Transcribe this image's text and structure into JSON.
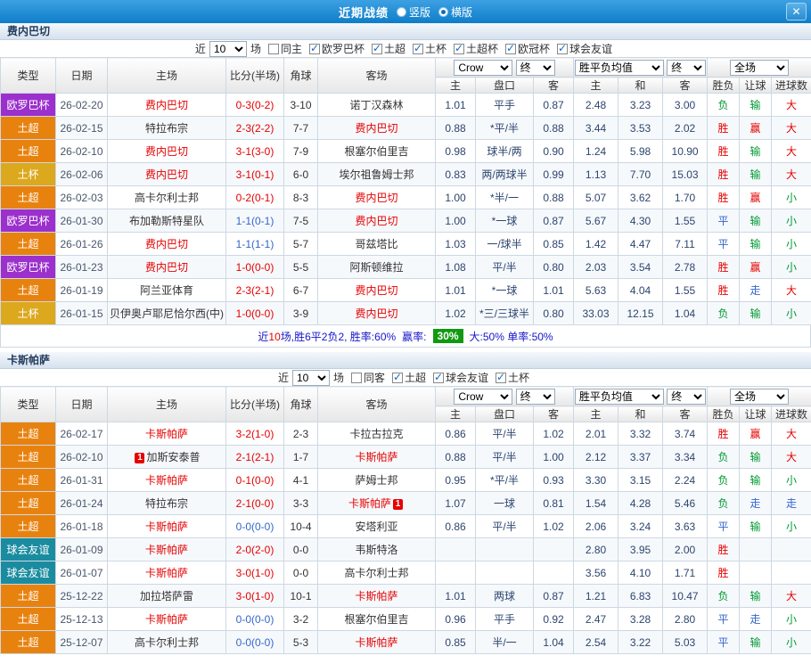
{
  "titlebar": {
    "title": "近期战绩",
    "layout_vertical": "竖版",
    "layout_horizontal": "横版",
    "selected_layout": "横版",
    "close": "✕"
  },
  "colors": {
    "titlebar_blue": "#1486d8",
    "europa_purple": "#9b30cc",
    "super_league_orange": "#e8820f",
    "cup_gold": "#dca81e",
    "friendly_teal": "#1b8ca0",
    "win_red": "#e60000",
    "lose_green": "#009933",
    "draw_blue": "#3366cc",
    "rate_badge_green": "#119911"
  },
  "columns": {
    "type": "类型",
    "date": "日期",
    "home": "主场",
    "score": "比分(半场)",
    "corner": "角球",
    "away": "客场",
    "crow": "Crow",
    "final": "终",
    "avg": "胜平负均值",
    "scope": "全场",
    "odds_home": "主",
    "odds_line": "盘口",
    "odds_away": "客",
    "avg_home": "主",
    "avg_draw": "和",
    "avg_away": "客",
    "result": "胜负",
    "let_ball": "让球",
    "goals": "进球数"
  },
  "filter": {
    "near": "近",
    "count": "10",
    "unit": "场"
  },
  "sections": [
    {
      "team": "费内巴切",
      "filters": [
        {
          "label": "同主",
          "state": "off"
        },
        {
          "label": "欧罗巴杯",
          "state": "on"
        },
        {
          "label": "土超",
          "state": "on"
        },
        {
          "label": "土杯",
          "state": "on"
        },
        {
          "label": "土超杯",
          "state": "on"
        },
        {
          "label": "欧冠杯",
          "state": "on"
        },
        {
          "label": "球会友谊",
          "state": "on"
        }
      ],
      "rows": [
        {
          "type": "欧罗巴杯",
          "tcls": "purple",
          "date": "26-02-20",
          "home": "费内巴切",
          "hcls": "hl",
          "score": "0-3(0-2)",
          "scls": "red",
          "corner": "3-10",
          "away": "诺丁汉森林",
          "acls": "",
          "c1": "1.01",
          "line": "平手",
          "c2": "0.87",
          "m1": "2.48",
          "m2": "3.23",
          "m3": "3.00",
          "res": "负",
          "rcls": "green",
          "let": "输",
          "lcls": "green",
          "big": "大",
          "bcls": "red"
        },
        {
          "type": "土超",
          "tcls": "orange",
          "date": "26-02-15",
          "home": "特拉布宗",
          "hcls": "",
          "score": "2-3(2-2)",
          "scls": "red",
          "corner": "7-7",
          "away": "费内巴切",
          "acls": "hl",
          "c1": "0.88",
          "line": "*平/半",
          "c2": "0.88",
          "m1": "3.44",
          "m2": "3.53",
          "m3": "2.02",
          "res": "胜",
          "rcls": "red",
          "let": "赢",
          "lcls": "red",
          "big": "大",
          "bcls": "red"
        },
        {
          "type": "土超",
          "tcls": "orange",
          "date": "26-02-10",
          "home": "费内巴切",
          "hcls": "hl",
          "score": "3-1(3-0)",
          "scls": "red",
          "corner": "7-9",
          "away": "根塞尔伯里吉",
          "acls": "",
          "c1": "0.98",
          "line": "球半/两",
          "c2": "0.90",
          "m1": "1.24",
          "m2": "5.98",
          "m3": "10.90",
          "res": "胜",
          "rcls": "red",
          "let": "输",
          "lcls": "green",
          "big": "大",
          "bcls": "red"
        },
        {
          "type": "土杯",
          "tcls": "gold",
          "date": "26-02-06",
          "home": "费内巴切",
          "hcls": "hl",
          "score": "3-1(0-1)",
          "scls": "red",
          "corner": "6-0",
          "away": "埃尔祖鲁姆士邦",
          "acls": "",
          "c1": "0.83",
          "line": "两/两球半",
          "c2": "0.99",
          "m1": "1.13",
          "m2": "7.70",
          "m3": "15.03",
          "res": "胜",
          "rcls": "red",
          "let": "输",
          "lcls": "green",
          "big": "大",
          "bcls": "red"
        },
        {
          "type": "土超",
          "tcls": "orange",
          "date": "26-02-03",
          "home": "高卡尔利士邦",
          "hcls": "",
          "score": "0-2(0-1)",
          "scls": "red",
          "corner": "8-3",
          "away": "费内巴切",
          "acls": "hl",
          "c1": "1.00",
          "line": "*半/一",
          "c2": "0.88",
          "m1": "5.07",
          "m2": "3.62",
          "m3": "1.70",
          "res": "胜",
          "rcls": "red",
          "let": "赢",
          "lcls": "red",
          "big": "小",
          "bcls": "green"
        },
        {
          "type": "欧罗巴杯",
          "tcls": "purple",
          "date": "26-01-30",
          "home": "布加勒斯特星队",
          "hcls": "",
          "score": "1-1(0-1)",
          "scls": "blue",
          "corner": "7-5",
          "away": "费内巴切",
          "acls": "hl",
          "c1": "1.00",
          "line": "*一球",
          "c2": "0.87",
          "m1": "5.67",
          "m2": "4.30",
          "m3": "1.55",
          "res": "平",
          "rcls": "blue",
          "let": "输",
          "lcls": "green",
          "big": "小",
          "bcls": "green"
        },
        {
          "type": "土超",
          "tcls": "orange",
          "date": "26-01-26",
          "home": "费内巴切",
          "hcls": "hl",
          "score": "1-1(1-1)",
          "scls": "blue",
          "corner": "5-7",
          "away": "哥兹塔比",
          "acls": "",
          "c1": "1.03",
          "line": "一/球半",
          "c2": "0.85",
          "m1": "1.42",
          "m2": "4.47",
          "m3": "7.11",
          "res": "平",
          "rcls": "blue",
          "let": "输",
          "lcls": "green",
          "big": "小",
          "bcls": "green"
        },
        {
          "type": "欧罗巴杯",
          "tcls": "purple",
          "date": "26-01-23",
          "home": "费内巴切",
          "hcls": "hl",
          "score": "1-0(0-0)",
          "scls": "red",
          "corner": "5-5",
          "away": "阿斯顿维拉",
          "acls": "",
          "c1": "1.08",
          "line": "平/半",
          "c2": "0.80",
          "m1": "2.03",
          "m2": "3.54",
          "m3": "2.78",
          "res": "胜",
          "rcls": "red",
          "let": "赢",
          "lcls": "red",
          "big": "小",
          "bcls": "green"
        },
        {
          "type": "土超",
          "tcls": "orange",
          "date": "26-01-19",
          "home": "阿兰亚体育",
          "hcls": "",
          "score": "2-3(2-1)",
          "scls": "red",
          "corner": "6-7",
          "away": "费内巴切",
          "acls": "hl",
          "c1": "1.01",
          "line": "*一球",
          "c2": "1.01",
          "m1": "5.63",
          "m2": "4.04",
          "m3": "1.55",
          "res": "胜",
          "rcls": "red",
          "let": "走",
          "lcls": "blue",
          "big": "大",
          "bcls": "red"
        },
        {
          "type": "土杯",
          "tcls": "gold",
          "date": "26-01-15",
          "home": "贝伊奥卢耶尼恰尔西(中)",
          "hcls": "",
          "score": "1-0(0-0)",
          "scls": "red",
          "corner": "3-9",
          "away": "费内巴切",
          "acls": "hl",
          "c1": "1.02",
          "line": "*三/三球半",
          "c2": "0.80",
          "m1": "33.03",
          "m2": "12.15",
          "m3": "1.04",
          "res": "负",
          "rcls": "green",
          "let": "输",
          "lcls": "green",
          "big": "小",
          "bcls": "green"
        }
      ],
      "summary": {
        "near": "近",
        "count": "10",
        "stats": "场,胜6平2负2, 胜率:60%",
        "win_label": "赢率:",
        "win_rate": "30%",
        "tail": "大:50% 单率:50%"
      }
    },
    {
      "team": "卡斯帕萨",
      "filters": [
        {
          "label": "同客",
          "state": "off"
        },
        {
          "label": "土超",
          "state": "on"
        },
        {
          "label": "球会友谊",
          "state": "on"
        },
        {
          "label": "土杯",
          "state": "on"
        }
      ],
      "rows": [
        {
          "type": "土超",
          "tcls": "orange",
          "date": "26-02-17",
          "home": "卡斯帕萨",
          "hcls": "hl",
          "score": "3-2(1-0)",
          "scls": "red",
          "corner": "2-3",
          "away": "卡拉古拉克",
          "acls": "",
          "c1": "0.86",
          "line": "平/半",
          "c2": "1.02",
          "m1": "2.01",
          "m2": "3.32",
          "m3": "3.74",
          "res": "胜",
          "rcls": "red",
          "let": "赢",
          "lcls": "red",
          "big": "大",
          "bcls": "red"
        },
        {
          "type": "土超",
          "tcls": "orange",
          "date": "26-02-10",
          "hpre": "1",
          "home": "加斯安泰普",
          "hcls": "",
          "score": "2-1(2-1)",
          "scls": "red",
          "corner": "1-7",
          "away": "卡斯帕萨",
          "acls": "hl",
          "c1": "0.88",
          "line": "平/半",
          "c2": "1.00",
          "m1": "2.12",
          "m2": "3.37",
          "m3": "3.34",
          "res": "负",
          "rcls": "green",
          "let": "输",
          "lcls": "green",
          "big": "大",
          "bcls": "red"
        },
        {
          "type": "土超",
          "tcls": "orange",
          "date": "26-01-31",
          "home": "卡斯帕萨",
          "hcls": "hl",
          "score": "0-1(0-0)",
          "scls": "red",
          "corner": "4-1",
          "away": "萨姆士邦",
          "acls": "",
          "c1": "0.95",
          "line": "*平/半",
          "c2": "0.93",
          "m1": "3.30",
          "m2": "3.15",
          "m3": "2.24",
          "res": "负",
          "rcls": "green",
          "let": "输",
          "lcls": "green",
          "big": "小",
          "bcls": "green"
        },
        {
          "type": "土超",
          "tcls": "orange",
          "date": "26-01-24",
          "home": "特拉布宗",
          "hcls": "",
          "score": "2-1(0-0)",
          "scls": "red",
          "corner": "3-3",
          "away": "卡斯帕萨",
          "acls": "hl",
          "apost": "1",
          "c1": "1.07",
          "line": "一球",
          "c2": "0.81",
          "m1": "1.54",
          "m2": "4.28",
          "m3": "5.46",
          "res": "负",
          "rcls": "green",
          "let": "走",
          "lcls": "blue",
          "big": "走",
          "bcls": "blue"
        },
        {
          "type": "土超",
          "tcls": "orange",
          "date": "26-01-18",
          "home": "卡斯帕萨",
          "hcls": "hl",
          "score": "0-0(0-0)",
          "scls": "blue",
          "corner": "10-4",
          "away": "安塔利亚",
          "acls": "",
          "c1": "0.86",
          "line": "平/半",
          "c2": "1.02",
          "m1": "2.06",
          "m2": "3.24",
          "m3": "3.63",
          "res": "平",
          "rcls": "blue",
          "let": "输",
          "lcls": "green",
          "big": "小",
          "bcls": "green"
        },
        {
          "type": "球会友谊",
          "tcls": "teal",
          "date": "26-01-09",
          "home": "卡斯帕萨",
          "hcls": "hl",
          "score": "2-0(2-0)",
          "scls": "red",
          "corner": "0-0",
          "away": "韦斯特洛",
          "acls": "",
          "c1": "",
          "line": "",
          "c2": "",
          "m1": "2.80",
          "m2": "3.95",
          "m3": "2.00",
          "res": "胜",
          "rcls": "red",
          "let": "",
          "lcls": "",
          "big": "",
          "bcls": ""
        },
        {
          "type": "球会友谊",
          "tcls": "teal",
          "date": "26-01-07",
          "home": "卡斯帕萨",
          "hcls": "hl",
          "score": "3-0(1-0)",
          "scls": "red",
          "corner": "0-0",
          "away": "高卡尔利士邦",
          "acls": "",
          "c1": "",
          "line": "",
          "c2": "",
          "m1": "3.56",
          "m2": "4.10",
          "m3": "1.71",
          "res": "胜",
          "rcls": "red",
          "let": "",
          "lcls": "",
          "big": "",
          "bcls": ""
        },
        {
          "type": "土超",
          "tcls": "orange",
          "date": "25-12-22",
          "home": "加拉塔萨雷",
          "hcls": "",
          "score": "3-0(1-0)",
          "scls": "red",
          "corner": "10-1",
          "away": "卡斯帕萨",
          "acls": "hl",
          "c1": "1.01",
          "line": "两球",
          "c2": "0.87",
          "m1": "1.21",
          "m2": "6.83",
          "m3": "10.47",
          "res": "负",
          "rcls": "green",
          "let": "输",
          "lcls": "green",
          "big": "大",
          "bcls": "red"
        },
        {
          "type": "土超",
          "tcls": "orange",
          "date": "25-12-13",
          "home": "卡斯帕萨",
          "hcls": "hl",
          "score": "0-0(0-0)",
          "scls": "blue",
          "corner": "3-2",
          "away": "根塞尔伯里吉",
          "acls": "",
          "c1": "0.96",
          "line": "平手",
          "c2": "0.92",
          "m1": "2.47",
          "m2": "3.28",
          "m3": "2.80",
          "res": "平",
          "rcls": "blue",
          "let": "走",
          "lcls": "blue",
          "big": "小",
          "bcls": "green"
        },
        {
          "type": "土超",
          "tcls": "orange",
          "date": "25-12-07",
          "home": "高卡尔利士邦",
          "hcls": "",
          "score": "0-0(0-0)",
          "scls": "blue",
          "corner": "5-3",
          "away": "卡斯帕萨",
          "acls": "hl",
          "c1": "0.85",
          "line": "半/一",
          "c2": "1.04",
          "m1": "2.54",
          "m2": "3.22",
          "m3": "5.03",
          "res": "平",
          "rcls": "blue",
          "let": "输",
          "lcls": "green",
          "big": "小",
          "bcls": "green"
        }
      ]
    }
  ]
}
